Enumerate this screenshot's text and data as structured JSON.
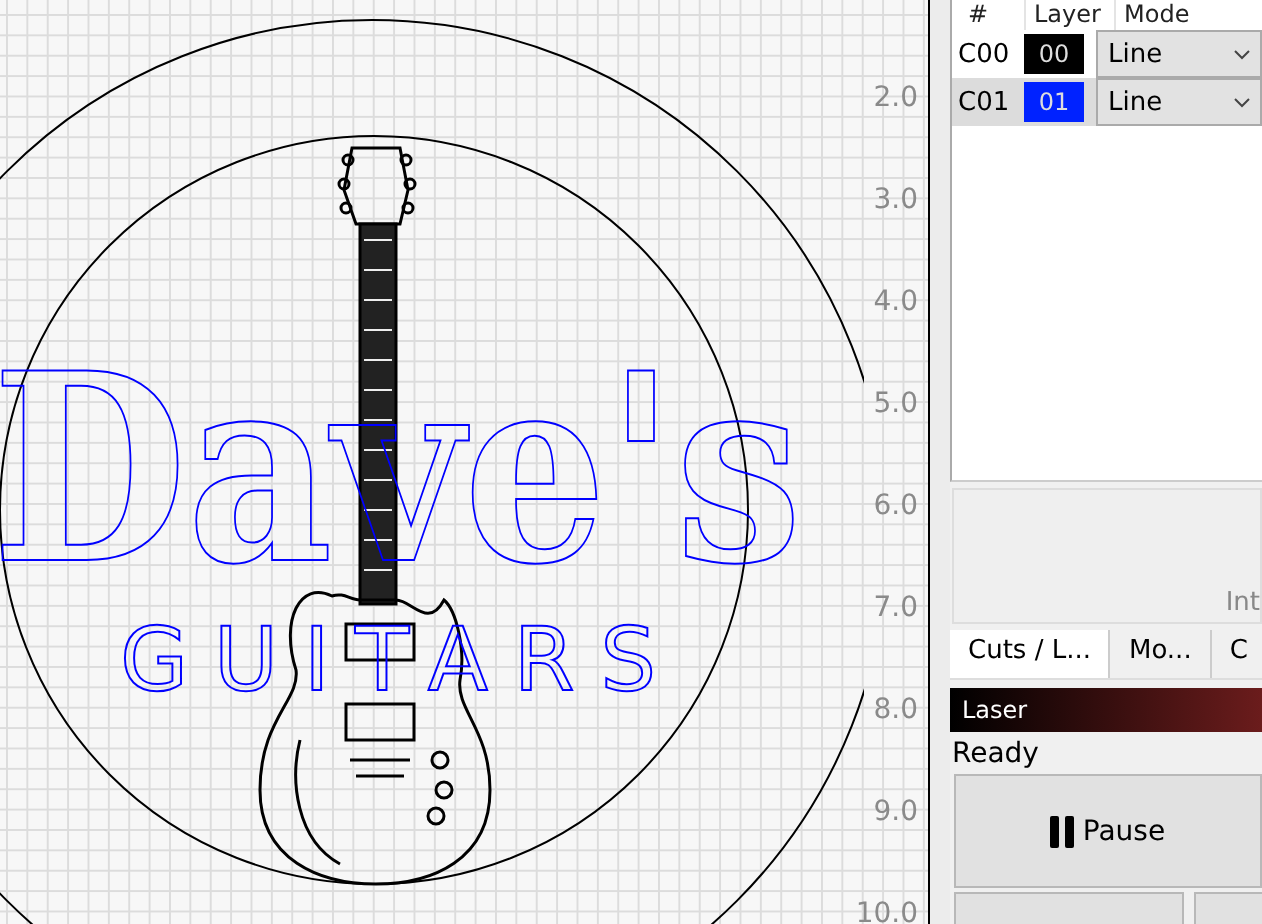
{
  "canvas": {
    "design_texts": [
      {
        "kind": "script",
        "text": "Dave's"
      },
      {
        "kind": "caps",
        "text": "GUITARS"
      }
    ],
    "ruler": [
      "2.0",
      "3.0",
      "4.0",
      "5.0",
      "6.0",
      "7.0",
      "8.0",
      "9.0",
      "10.0"
    ]
  },
  "layers": {
    "columns": [
      "#",
      "Layer",
      "Mode"
    ],
    "rows": [
      {
        "id": "C00",
        "layer": "00",
        "color": "#000000",
        "mode": "Line",
        "selected": false
      },
      {
        "id": "C01",
        "layer": "01",
        "color": "#0022ff",
        "mode": "Line",
        "selected": true
      }
    ]
  },
  "info": {
    "text": "Int"
  },
  "tabs": [
    {
      "label": "Cuts / L...",
      "selected": true
    },
    {
      "label": "Mo...",
      "selected": false
    },
    {
      "label": "C",
      "selected": false
    }
  ],
  "laser": {
    "title": "Laser",
    "status": "Ready",
    "pause_button": "Pause"
  }
}
